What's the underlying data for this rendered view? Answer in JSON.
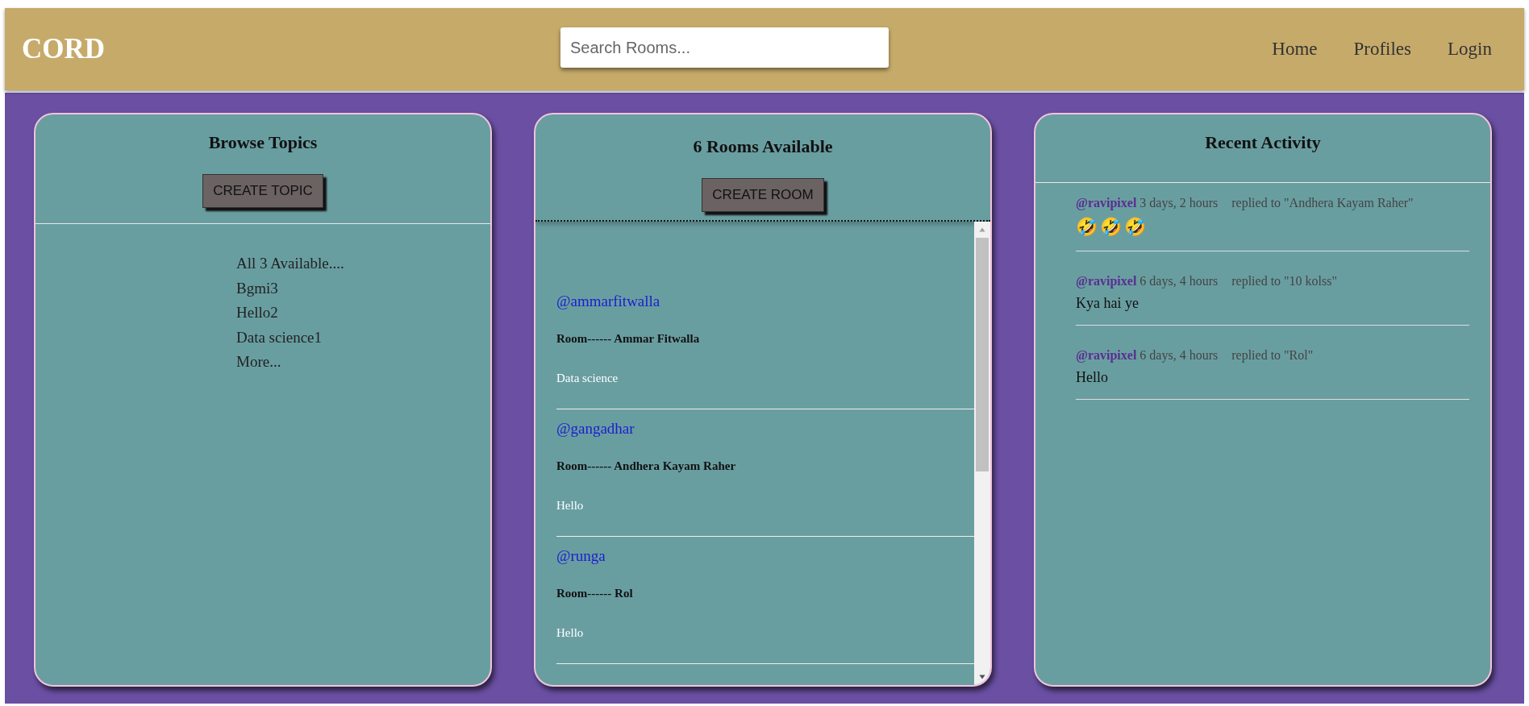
{
  "header": {
    "logo": "CORD",
    "search": {
      "placeholder": "Search Rooms..."
    },
    "nav": [
      "Home",
      "Profiles",
      "Login"
    ]
  },
  "topics": {
    "title": "Browse Topics",
    "button": "CREATE TOPIC",
    "items": [
      "All 3 Available....",
      "Bgmi3",
      "Hello2",
      "Data science1",
      "More..."
    ]
  },
  "rooms": {
    "title": "6 Rooms Available",
    "button": "CREATE ROOM",
    "items": [
      {
        "host": "@ammarfitwalla",
        "room": "Room------ Ammar Fitwalla",
        "topic": "Data science"
      },
      {
        "host": "@gangadhar",
        "room": "Room------ Andhera Kayam Raher",
        "topic": "Hello"
      },
      {
        "host": "@runga",
        "room": "Room------ Rol",
        "topic": "Hello"
      }
    ]
  },
  "activity": {
    "title": "Recent Activity",
    "items": [
      {
        "user": "@ravipixel",
        "time": "3 days, 2 hours",
        "action": "replied to \"Andhera Kayam Raher\"",
        "kind": "emoji",
        "body": "🤣🤣🤣"
      },
      {
        "user": "@ravipixel",
        "time": "6 days, 4 hours",
        "action": "replied to \"10 kolss\"",
        "kind": "text",
        "body": "Kya hai ye"
      },
      {
        "user": "@ravipixel",
        "time": "6 days, 4 hours",
        "action": "replied to \"Rol\"",
        "kind": "text",
        "body": "Hello"
      }
    ]
  }
}
